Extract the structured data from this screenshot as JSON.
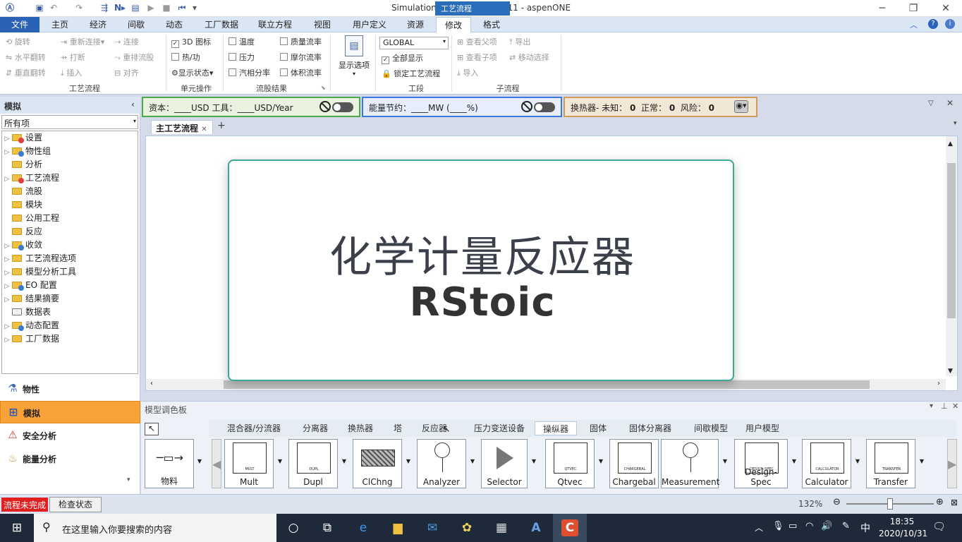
{
  "window": {
    "title": "Simulation 3 - Aspen Plus V11 - aspenONE",
    "context_tab": "工艺流程",
    "min": "─",
    "max": "❐",
    "close": "✕"
  },
  "ribbon_tabs": [
    "文件",
    "主页",
    "经济",
    "间歇",
    "动态",
    "工厂数据",
    "联立方程",
    "视图",
    "用户定义",
    "资源",
    "修改",
    "格式"
  ],
  "search": {
    "placeholder": "搜索aspenONE Exchange"
  },
  "ribbon": {
    "flowsheet_group": {
      "items": [
        "旋转",
        "水平翻转",
        "垂直翻转",
        "重新连接",
        "打断",
        "插入",
        "连接",
        "重排流股",
        "对齐"
      ],
      "label": "工艺流程"
    },
    "unit_ops": {
      "items": [
        "3D 图标",
        "热/功",
        "显示状态"
      ],
      "label": "单元操作"
    },
    "stream_results": {
      "items": [
        "温度",
        "压力",
        "汽相分率",
        "质量流率",
        "摩尔流率",
        "体积流率"
      ],
      "label": "流股结果"
    },
    "display_options": "显示选项",
    "section": {
      "combo": "GLOBAL",
      "items": [
        "全部显示",
        "锁定工艺流程"
      ],
      "label": "工段"
    },
    "subflowsheet": {
      "items": [
        "查看父项",
        "查看子项",
        "导入",
        "导出",
        "移动选择"
      ],
      "label": "子流程"
    }
  },
  "left_pane": {
    "header": "模拟",
    "combo": "所有项",
    "tree": [
      {
        "label": "设置",
        "status": "red"
      },
      {
        "label": "物性组",
        "status": "blue"
      },
      {
        "label": "分析",
        "status": "none"
      },
      {
        "label": "工艺流程",
        "status": "red"
      },
      {
        "label": "流股",
        "status": "none"
      },
      {
        "label": "模块",
        "status": "none"
      },
      {
        "label": "公用工程",
        "status": "none"
      },
      {
        "label": "反应",
        "status": "none"
      },
      {
        "label": "收敛",
        "status": "blue"
      },
      {
        "label": "工艺流程选项",
        "status": "none"
      },
      {
        "label": "模型分析工具",
        "status": "none"
      },
      {
        "label": "EO 配置",
        "status": "blue"
      },
      {
        "label": "结果摘要",
        "status": "none"
      },
      {
        "label": "数据表",
        "status": "none"
      },
      {
        "label": "动态配置",
        "status": "blue"
      },
      {
        "label": "工厂数据",
        "status": "none"
      }
    ],
    "nav": [
      "物性",
      "模拟",
      "安全分析",
      "能量分析"
    ]
  },
  "status_bars": {
    "cost": "资本：____USD   工具：____USD/Year",
    "energy": "能量节约：____MW   (____%)",
    "hx": "换热器-  未知：",
    "hx_unknown": "0",
    "hx_normal_label": "正常：",
    "hx_normal": "0",
    "hx_risk_label": "风险：",
    "hx_risk": "0"
  },
  "doc_tab": {
    "label": "主工艺流程",
    "close": "✕",
    "add": "+"
  },
  "card": {
    "cn": "化学计量反应器",
    "en": "RStoic"
  },
  "palette": {
    "title": "模型调色板",
    "tabs": [
      "混合器/分流器",
      "分离器",
      "换热器",
      "塔",
      "反应器",
      "压力变送设备",
      "操纵器",
      "固体",
      "固体分离器",
      "间歇模型",
      "用户模型"
    ],
    "first_item": "物料",
    "items": [
      "Mult",
      "Dupl",
      "ClChng",
      "Analyzer",
      "Selector",
      "Qtvec",
      "Chargebal",
      "Measurement",
      "Design-Spec",
      "Calculator",
      "Transfer"
    ],
    "item_tags": [
      "MULT",
      "DUPL",
      "",
      "",
      "",
      "QTVEC",
      "CHARGEBAL",
      "",
      "DESIGN-SPEC",
      "CALCULATOR",
      "TRANSFER"
    ]
  },
  "statusbar": {
    "incomplete": "流程未完成",
    "check": "检查状态",
    "zoom": "132%"
  },
  "taskbar": {
    "search": "在这里输入你要搜索的内容",
    "time": "18:35",
    "date": "2020/10/31",
    "ime": "中"
  }
}
